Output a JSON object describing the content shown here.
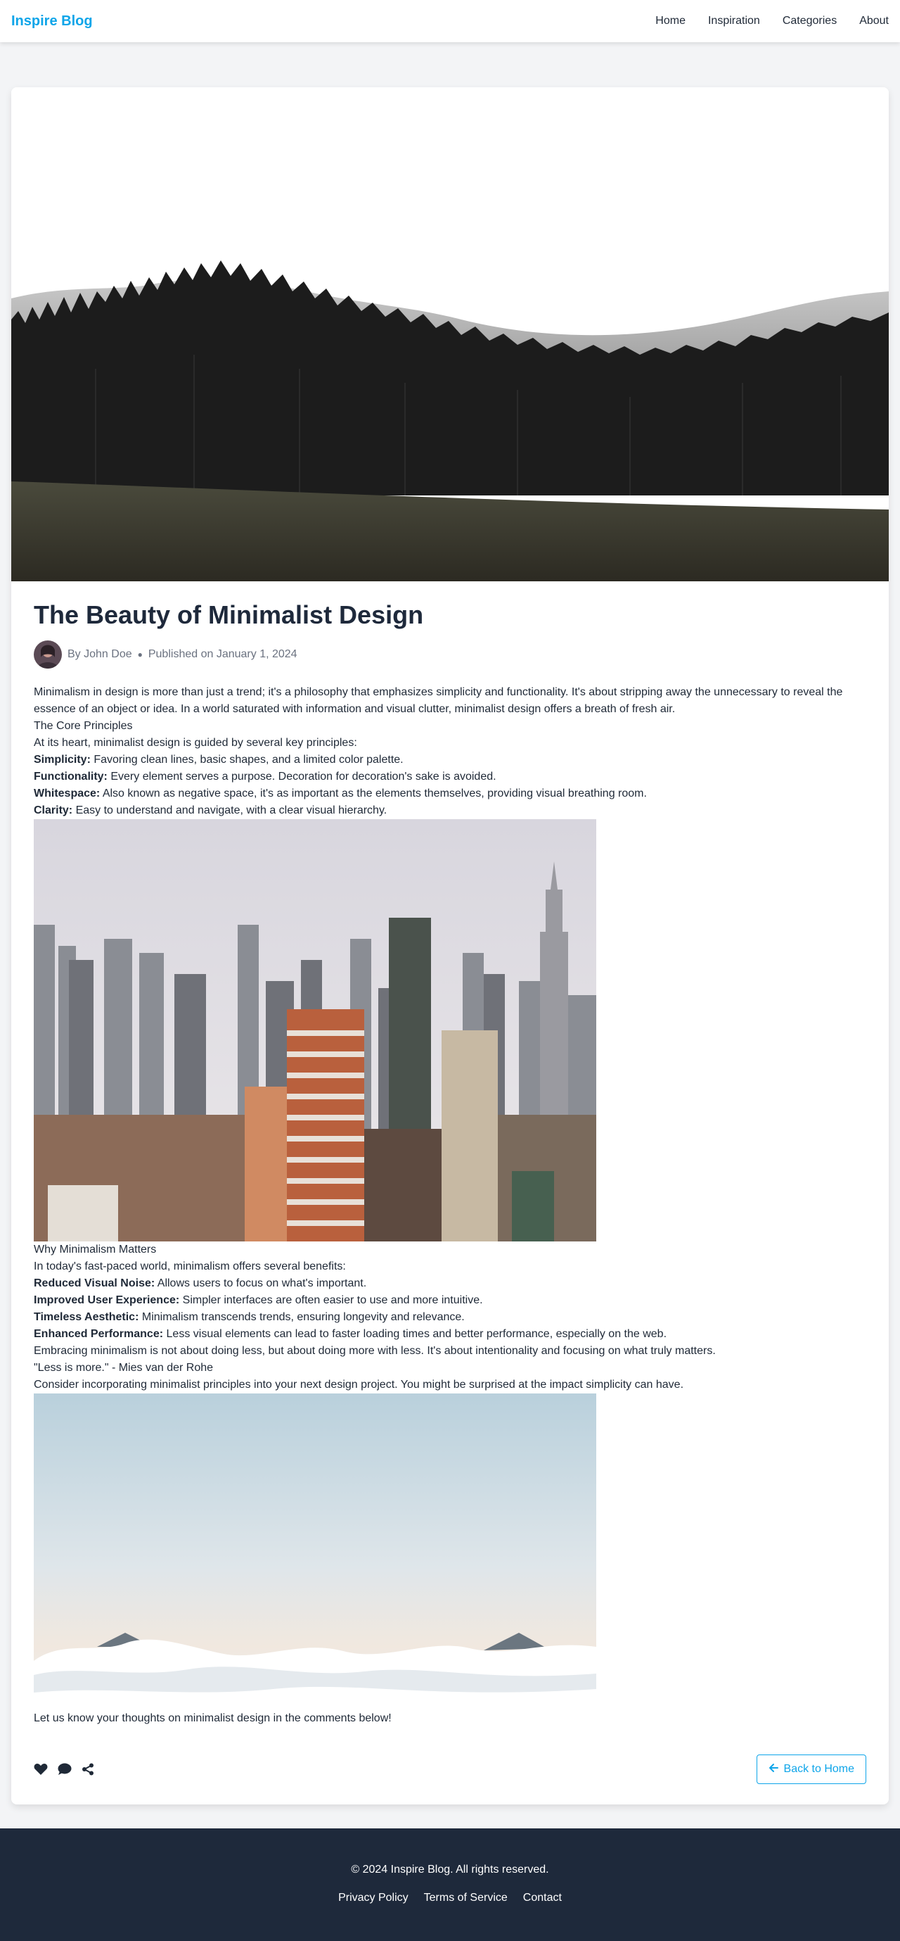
{
  "header": {
    "brand": "Inspire Blog",
    "nav": [
      "Home",
      "Inspiration",
      "Categories",
      "About"
    ]
  },
  "article": {
    "title": "The Beauty of Minimalist Design",
    "author": "By John Doe",
    "published": "Published on January 1, 2024",
    "intro": "Minimalism in design is more than just a trend; it's a philosophy that emphasizes simplicity and functionality. It's about stripping away the unnecessary to reveal the essence of an object or idea. In a world saturated with information and visual clutter, minimalist design offers a breath of fresh air.",
    "section1_heading": "The Core Principles",
    "section1_lead": "At its heart, minimalist design is guided by several key principles:",
    "principles": [
      {
        "term": "Simplicity:",
        "text": "Favoring clean lines, basic shapes, and a limited color palette."
      },
      {
        "term": "Functionality:",
        "text": "Every element serves a purpose. Decoration for decoration's sake is avoided."
      },
      {
        "term": "Whitespace:",
        "text": "Also known as negative space, it's as important as the elements themselves, providing visual breathing room."
      },
      {
        "term": "Clarity:",
        "text": "Easy to understand and navigate, with a clear visual hierarchy."
      }
    ],
    "section2_heading": "Why Minimalism Matters",
    "section2_lead": "In today's fast-paced world, minimalism offers several benefits:",
    "benefits": [
      {
        "term": "Reduced Visual Noise:",
        "text": "Allows users to focus on what's important."
      },
      {
        "term": "Improved User Experience:",
        "text": "Simpler interfaces are often easier to use and more intuitive."
      },
      {
        "term": "Timeless Aesthetic:",
        "text": "Minimalism transcends trends, ensuring longevity and relevance."
      },
      {
        "term": "Enhanced Performance:",
        "text": "Less visual elements can lead to faster loading times and better performance, especially on the web."
      }
    ],
    "para_embrace": "Embracing minimalism is not about doing less, but about doing more with less. It's about intentionality and focusing on what truly matters.",
    "quote": "\"Less is more.\" - Mies van der Rohe",
    "para_consider": "Consider incorporating minimalist principles into your next design project. You might be surprised at the impact simplicity can have.",
    "closing": "Let us know your thoughts on minimalist design in the comments below!",
    "back_label": "Back to Home"
  },
  "icons": {
    "like": "heart-icon",
    "comment": "comment-icon",
    "share": "share-icon",
    "back": "arrow-left-icon"
  },
  "colors": {
    "accent": "#0ea5e9",
    "footer_bg": "#1e293b",
    "page_bg": "#f3f4f6"
  },
  "footer": {
    "copyright": "© 2024 Inspire Blog. All rights reserved.",
    "links": [
      "Privacy Policy",
      "Terms of Service",
      "Contact"
    ]
  }
}
